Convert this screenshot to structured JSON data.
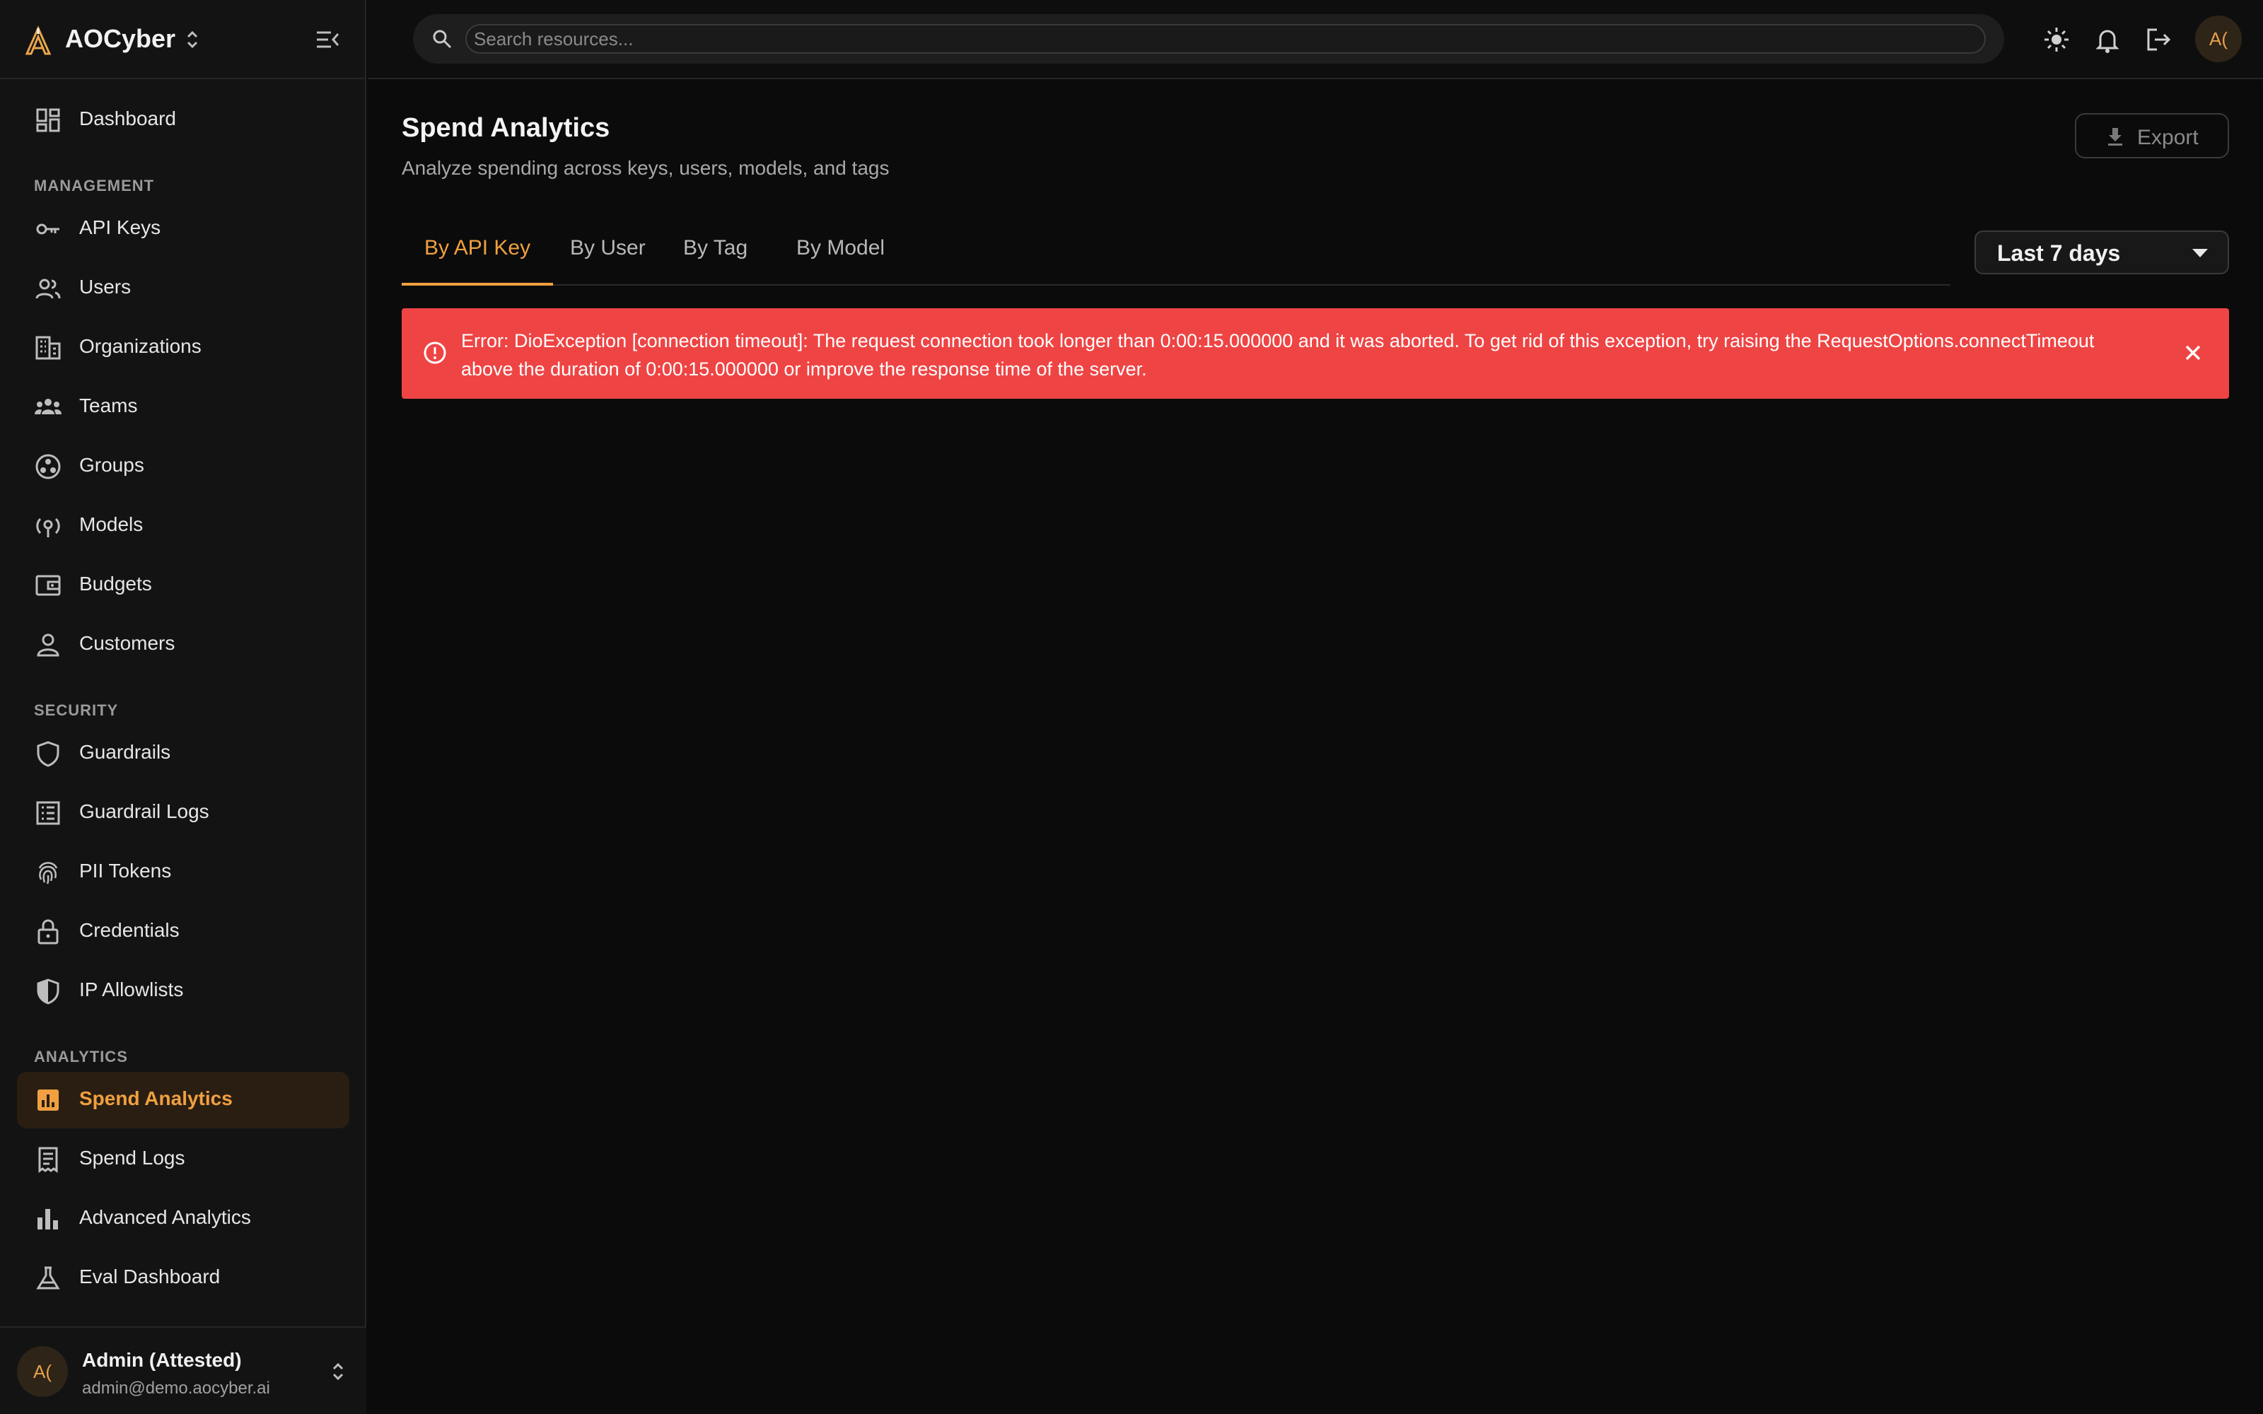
{
  "brand": {
    "name": "AOCyber"
  },
  "sidebar": {
    "top_items": [
      {
        "label": "Dashboard",
        "icon": "dashboard-icon"
      }
    ],
    "sections": [
      {
        "label": "MANAGEMENT",
        "items": [
          {
            "label": "API Keys",
            "icon": "key-icon"
          },
          {
            "label": "Users",
            "icon": "users-icon"
          },
          {
            "label": "Organizations",
            "icon": "building-icon"
          },
          {
            "label": "Teams",
            "icon": "teams-icon"
          },
          {
            "label": "Groups",
            "icon": "groups-icon"
          },
          {
            "label": "Models",
            "icon": "models-icon"
          },
          {
            "label": "Budgets",
            "icon": "wallet-icon"
          },
          {
            "label": "Customers",
            "icon": "person-icon"
          }
        ]
      },
      {
        "label": "SECURITY",
        "items": [
          {
            "label": "Guardrails",
            "icon": "shield-icon"
          },
          {
            "label": "Guardrail Logs",
            "icon": "log-list-icon"
          },
          {
            "label": "PII Tokens",
            "icon": "fingerprint-icon"
          },
          {
            "label": "Credentials",
            "icon": "lock-icon"
          },
          {
            "label": "IP Allowlists",
            "icon": "shield-half-icon"
          }
        ]
      },
      {
        "label": "ANALYTICS",
        "items": [
          {
            "label": "Spend Analytics",
            "icon": "analytics-icon",
            "active": true
          },
          {
            "label": "Spend Logs",
            "icon": "receipt-icon"
          },
          {
            "label": "Advanced Analytics",
            "icon": "bar-chart-icon"
          },
          {
            "label": "Eval Dashboard",
            "icon": "flask-icon"
          }
        ]
      }
    ]
  },
  "user": {
    "initials": "A(",
    "name": "Admin (Attested)",
    "email": "admin@demo.aocyber.ai"
  },
  "search": {
    "placeholder": "Search resources..."
  },
  "page": {
    "title": "Spend Analytics",
    "subtitle": "Analyze spending across keys, users, models, and tags",
    "export_label": "Export",
    "tabs": [
      "By API Key",
      "By User",
      "By Tag",
      "By Model"
    ],
    "active_tab": "By API Key",
    "range": "Last 7 days",
    "error": "Error: DioException [connection timeout]: The request connection took longer than 0:00:15.000000 and it was aborted. To get rid of this exception, try raising the RequestOptions.connectTimeout above the duration of 0:00:15.000000 or improve the response time of the server."
  },
  "colors": {
    "accent": "#f0a040",
    "error_bg": "#ef4444",
    "bg": "#0b0b0b",
    "sidebar_bg": "#131313"
  }
}
